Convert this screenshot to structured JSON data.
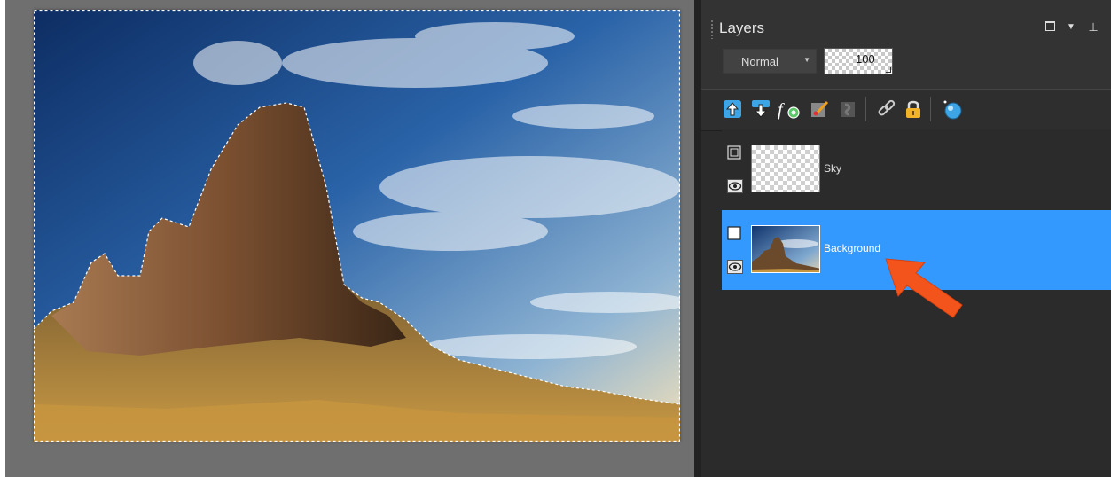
{
  "panel": {
    "title": "Layers",
    "blend_mode": "Normal",
    "opacity": "100"
  },
  "toolbar": {
    "icons": [
      "move-layer-up-icon",
      "move-layer-down-icon",
      "layer-effects-icon",
      "edit-mask-icon",
      "mask-icon",
      "link-layer-icon",
      "lock-layer-icon",
      "create-clone-icon"
    ]
  },
  "layers": [
    {
      "name": "Sky",
      "type": "empty-layer",
      "visible": true,
      "selected": false
    },
    {
      "name": "Background",
      "type": "image-layer",
      "visible": true,
      "selected": true
    }
  ],
  "colors": {
    "selection_highlight": "#3399ff",
    "annotation_arrow": "#f2541b",
    "panel_bg": "#2b2b2b"
  }
}
